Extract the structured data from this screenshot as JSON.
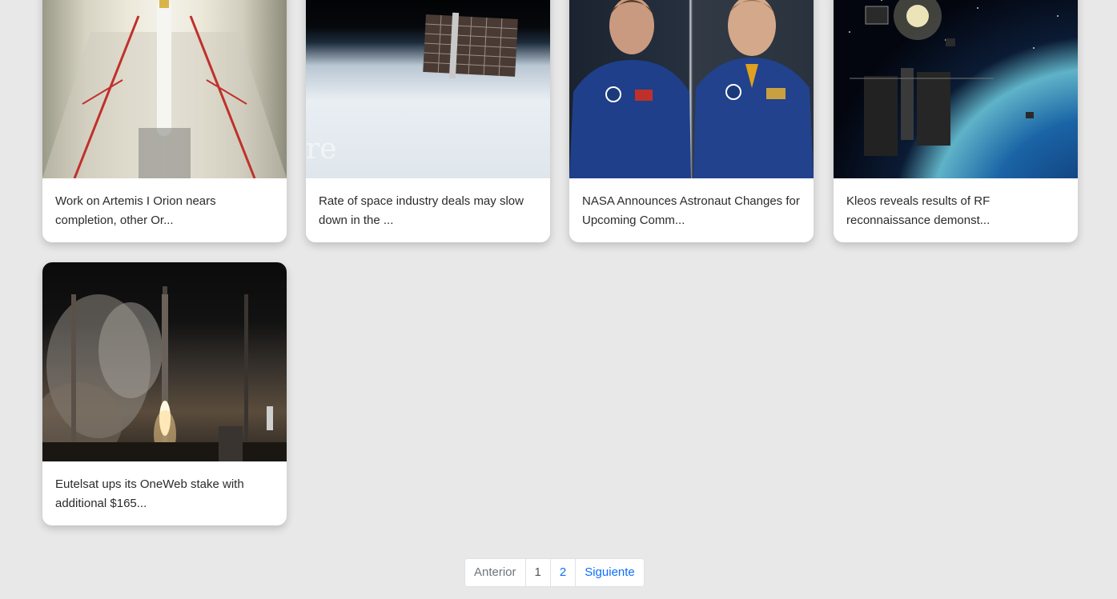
{
  "cards": [
    {
      "title": "Work on Artemis I Orion nears completion, other Or..."
    },
    {
      "title": "Rate of space industry deals may slow down in the ...",
      "image_overlay_text": "re"
    },
    {
      "title": "NASA Announces Astronaut Changes for Upcoming Comm..."
    },
    {
      "title": "Kleos reveals results of RF reconnaissance demonst..."
    },
    {
      "title": "Eutelsat ups its OneWeb stake with additional $165..."
    }
  ],
  "pagination": {
    "prev_label": "Anterior",
    "pages": [
      "1",
      "2"
    ],
    "next_label": "Siguiente"
  },
  "colors": {
    "background": "#e8e8e8",
    "card": "#ffffff",
    "link": "#0d6efd",
    "disabled": "#6c757d"
  }
}
